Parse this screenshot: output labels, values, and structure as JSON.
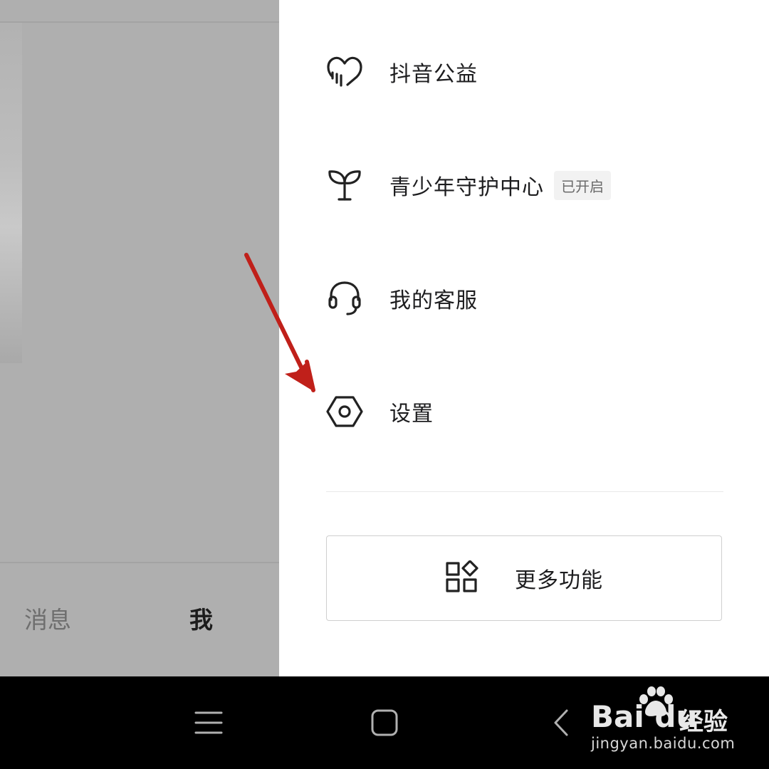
{
  "left_pane": {
    "tabs": [
      {
        "label": "消息"
      },
      {
        "label": "我"
      }
    ]
  },
  "drawer": {
    "menu_items": [
      {
        "label": "抖音公益",
        "icon": "charity-heart-icon"
      },
      {
        "label": "青少年守护中心",
        "icon": "sprout-icon",
        "badge": "已开启"
      },
      {
        "label": "我的客服",
        "icon": "headset-icon"
      },
      {
        "label": "设置",
        "icon": "settings-hexagon-icon"
      }
    ],
    "more_button": {
      "label": "更多功能",
      "icon": "grid-apps-icon"
    }
  },
  "annotation": {
    "arrow_color": "#c0201a"
  },
  "nav_bar": {
    "buttons": [
      "menu-icon",
      "home-square-icon",
      "back-chevron-icon"
    ]
  },
  "watermark": {
    "brand": "Bai  du",
    "product": "经验",
    "url": "jingyan.baidu.com"
  }
}
